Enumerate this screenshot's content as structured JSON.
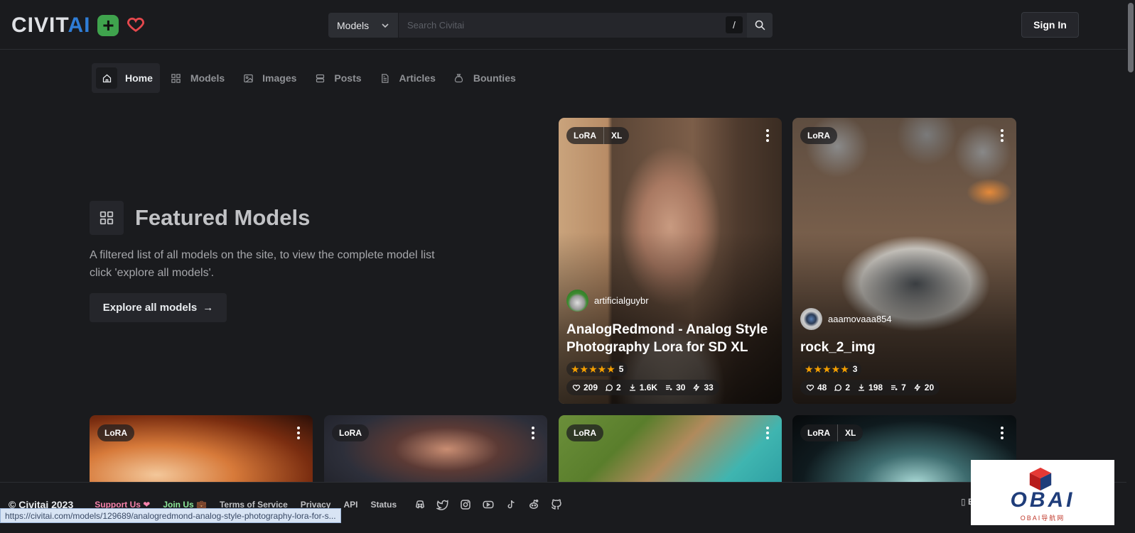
{
  "header": {
    "logo_main": "CIVIT",
    "logo_accent": "AI",
    "search_category": "Models",
    "search_placeholder": "Search Civitai",
    "search_shortcut": "/",
    "signin_label": "Sign In"
  },
  "nav": {
    "items": [
      {
        "label": "Home",
        "icon": "home-icon"
      },
      {
        "label": "Models",
        "icon": "grid-icon"
      },
      {
        "label": "Images",
        "icon": "image-icon"
      },
      {
        "label": "Posts",
        "icon": "posts-icon"
      },
      {
        "label": "Articles",
        "icon": "article-icon"
      },
      {
        "label": "Bounties",
        "icon": "moneybag-icon"
      }
    ]
  },
  "featured": {
    "title": "Featured Models",
    "description": "A filtered list of all models on the site, to view the complete model list click 'explore all models'.",
    "explore_label": "Explore all models",
    "explore_arrow": "→"
  },
  "cards": [
    {
      "badges": [
        "LoRA",
        "XL"
      ],
      "creator": "artificialguybr",
      "name": "AnalogRedmond - Analog Style Photography Lora for SD XL",
      "stars": "★★★★★",
      "rating_count": "5",
      "likes": "209",
      "comments": "2",
      "downloads": "1.6K",
      "collections": "30",
      "buzz": "33"
    },
    {
      "badges": [
        "LoRA"
      ],
      "creator": "aaamovaaa854",
      "name": "rock_2_img",
      "stars": "★★★★★",
      "rating_count": "3",
      "likes": "48",
      "comments": "2",
      "downloads": "198",
      "collections": "7",
      "buzz": "20"
    },
    {
      "badges": [
        "LoRA"
      ]
    },
    {
      "badges": [
        "LoRA"
      ]
    },
    {
      "badges": [
        "LoRA"
      ]
    },
    {
      "badges": [
        "LoRA",
        "XL"
      ]
    }
  ],
  "footer": {
    "copyright": "© Civitai 2023",
    "support": "Support Us ❤",
    "join": "Join Us 💼",
    "links": [
      "Terms of Service",
      "Privacy",
      "API",
      "Status"
    ],
    "socials": [
      "discord-icon",
      "twitter-icon",
      "instagram-icon",
      "youtube-icon",
      "tiktok-icon",
      "reddit-icon",
      "github-icon"
    ],
    "edge_fragment": "▯ E"
  },
  "statusbar_url": "https://civitai.com/models/129689/analogredmond-analog-style-photography-lora-for-s...",
  "watermark": {
    "text": "OBAI",
    "sub": "OBAI导航网"
  },
  "colors": {
    "background": "#1a1b1e",
    "accent": "#2f7dd6",
    "plus": "#3fa34d",
    "heart": "#e5484d",
    "star": "#f59f00"
  }
}
